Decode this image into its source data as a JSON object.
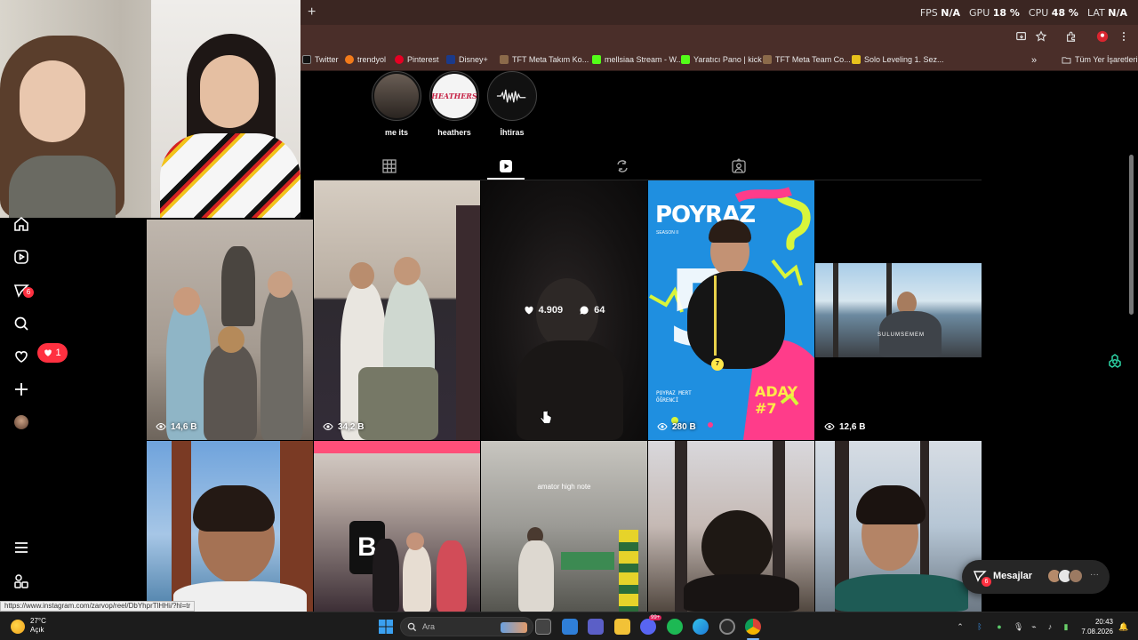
{
  "browser": {
    "new_tab": "+",
    "stats": {
      "fps_label": "FPS",
      "fps": "N/A",
      "gpu_label": "GPU",
      "gpu": "18 %",
      "cpu_label": "CPU",
      "cpu": "48 %",
      "lat_label": "LAT",
      "lat": "N/A"
    },
    "bookmarks": [
      {
        "label": "Twitter",
        "color": "#111111"
      },
      {
        "label": "trendyol",
        "color": "#f27a1a"
      },
      {
        "label": "Pinterest",
        "color": "#e60023"
      },
      {
        "label": "Disney+",
        "color": "#1b3a8a"
      },
      {
        "label": "TFT Meta Takım Ko...",
        "color": "#8b6a4a"
      },
      {
        "label": "mellsiaa Stream - W...",
        "color": "#53fc18"
      },
      {
        "label": "Yaratıcı Pano | kick",
        "color": "#53fc18"
      },
      {
        "label": "TFT Meta Team Co...",
        "color": "#8b6a4a"
      },
      {
        "label": "Solo Leveling 1. Sez...",
        "color": "#e7c21c"
      }
    ],
    "bookmarks_all": "Tüm Yer İşaretleri",
    "status_url": "https://www.instagram.com/zarvop/reel/DbYhprTlHHi/?hl=tr"
  },
  "sidebar": {
    "notif_count": "6",
    "likes_count": "1"
  },
  "profile": {
    "highlights": [
      {
        "label": "me its",
        "tone": "#3a3430"
      },
      {
        "label": "heathers",
        "tone": "#f4f4f4",
        "logo": "HEATHERS"
      },
      {
        "label": "İhtiras",
        "tone": "#1a1a1a"
      }
    ]
  },
  "grid": {
    "tiles": [
      {
        "views": "14,6 B"
      },
      {
        "views": "34,2 B"
      },
      {
        "likes": "4.909",
        "comments": "64"
      },
      {
        "views": "280 B",
        "poster": {
          "title": "POYRAZ",
          "season": "SEASON II",
          "number": "5",
          "aday": "ADAY #7",
          "badge": "7",
          "sub1": "POYRAZ MERT",
          "sub2": "ÖĞRENCİ"
        }
      },
      {
        "views": "12,6 B",
        "overlay": "SULUMSEMEM"
      },
      {},
      {},
      {
        "caption": "amator high note"
      },
      {},
      {}
    ]
  },
  "messages": {
    "label": "Mesajlar",
    "badge": "6",
    "more": "···"
  },
  "taskbar": {
    "temp": "27°C",
    "condition": "Açık",
    "search_placeholder": "Ara",
    "time": "20:43",
    "date": "7.08.2026",
    "icon_badge": "99+"
  },
  "colors": {
    "accent": "#ff3040",
    "instagram_bg": "#000000",
    "poster_blue": "#1f8fe0",
    "poster_pink": "#ff3c8a",
    "poster_lime": "#d9f53a"
  }
}
